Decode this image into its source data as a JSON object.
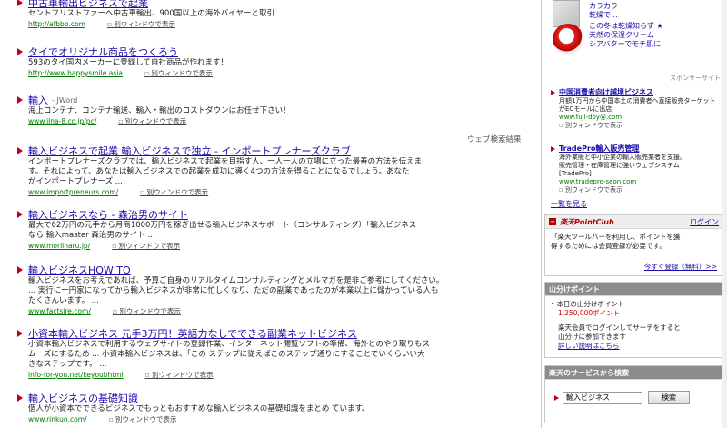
{
  "results": [
    {
      "title": "中古車輸出ビジネスで起業",
      "sub": "",
      "desc": [
        "セントフリストファーへ中古車輸出、900国以上の海外バイヤーと取引"
      ],
      "url": "http://afbbb.com",
      "newwin": "別ウィンドウで表示"
    },
    {
      "title": "タイでオリジナル商品をつくろう",
      "sub": "",
      "desc": [
        "593のタイ国内メーカーに登録して自社商品が作れます！"
      ],
      "url": "http://www.happysmile.asia",
      "newwin": "別ウィンドウで表示"
    },
    {
      "title": "輸入",
      "sub": "- JWord",
      "desc": [
        "海上コンテナ、コンテナ輸送、輸入・輸出のコストダウンはお任せ下さい！"
      ],
      "url": "www.ilna-8.co.jp/pc/",
      "newwin": "別ウィンドウで表示"
    },
    {
      "title": "輸入ビジネスで起業 輸入ビジネスで独立 - インポートプレナーズクラブ",
      "sub": "",
      "desc": [
        "インポートプレナーズクラブでは、輸入ビジネスで起業を目指す人、一人一人の立場に立った最善の方法を伝えま",
        "す。それによって、あなたは輸入ビジネスでの起業を成功に導く4つの方法を得ることになるでしょう。あなた",
        "がインポートプレナーズ ..."
      ],
      "url": "www.importpreneurs.com/",
      "newwin": "別ウィンドウで表示"
    },
    {
      "title": "輸入ビジネスなら - 森治男のサイト",
      "sub": "",
      "desc": [
        "最大で62万円の元手から月商1000万円を稼ぎ出せる輸入ビジネスサポート（コンサルティング）「輸入ビジネス",
        "なら 輸入master 森治男のサイト ..."
      ],
      "url": "www.morliharu.jp/",
      "newwin": "別ウィンドウで表示"
    },
    {
      "title": "輸入ビジネスHOW TO",
      "sub": "",
      "desc": [
        "輸入ビジネスをお考えであれば、予算ご自身のリアルタイムコンサルティングとメルマガを是非ご参考にしてください。",
        "... 実行に一円家になってから輸入ビジネスが非常に忙しくなり、ただの副業であったのが本業以上に儲かっている人も",
        "たくさんいます。 ..."
      ],
      "url": "www.factsire.com/",
      "newwin": "別ウィンドウで表示"
    },
    {
      "title": "小資本輸入ビジネス 元手3万円！英語力なしでできる副業ネットビジネス",
      "sub": "",
      "desc": [
        "小資本輸入ビジネスで利用するウェブサイトの登録作業、インターネット閲覧ソフトの準備、海外とのやり取りもス",
        "ムーズにするため ... 小資本輸入ビジネスは、「この ステップに従えばこのステップ通りにすることでいくらいい大",
        "きなステップです。 ..."
      ],
      "url": "info-for-you.net/keyoubhtml",
      "newwin": "別ウィンドウで表示"
    },
    {
      "title": "輸入ビジネスの基礎知識",
      "sub": "",
      "desc": [
        "個人が小資本でできるビジネスでもっともおすすめな輸入ビジネスの基礎知識をまとめ ています。"
      ],
      "url": "www.rinkun.com/",
      "newwin": "別ウィンドウで表示"
    }
  ],
  "web_label": "ウェブ検索結果",
  "sidebar": {
    "top_ad1": [
      "カラカラ",
      "乾燥で..."
    ],
    "top_ad2": [
      "この冬は乾燥知らず ★",
      "天然の保湿クリーム",
      "シアバターでモチ肌に"
    ],
    "sponsor_label": "スポンサーサイト",
    "ads": [
      {
        "title": "中国消費者向け越境ビジネス",
        "desc": [
          "月額1万円から中国本土の消費者へ直接販売ターゲットがECモールに出店"
        ],
        "url": "www.fujl-doy@.com",
        "newwin": "別ウィンドウで表示"
      },
      {
        "title": "TradePro輸入販売管理",
        "desc": [
          "海外業販と中小企業の輸入販売業者を支援。",
          "販売管理・在庫管理に強いウェブシステム",
          "[TradePro]"
        ],
        "url": "www.tradepro-seon.com",
        "newwin": "別ウィンドウで表示"
      }
    ],
    "more_link": "一覧を見る",
    "pointclub": {
      "header": "楽天PointClub",
      "login": "ログイン",
      "body": [
        "「楽天ツールバーを利用し、ポイントを獲",
        "得するためには会員登録が必要です。"
      ],
      "register": "今すぐ登録（無料）>>"
    },
    "yama": {
      "header": "山分けポイント",
      "line1": "本日の山分けポイント",
      "amount": "1,250,000ポイント",
      "body": [
        "楽天会員でログインしてサーチをすると",
        "山分けに参加できます"
      ],
      "link": "詳しい説明はこちら"
    },
    "service": {
      "header": "楽天のサービスから検索",
      "input": "輸入ビジネス",
      "button": "検索"
    }
  }
}
